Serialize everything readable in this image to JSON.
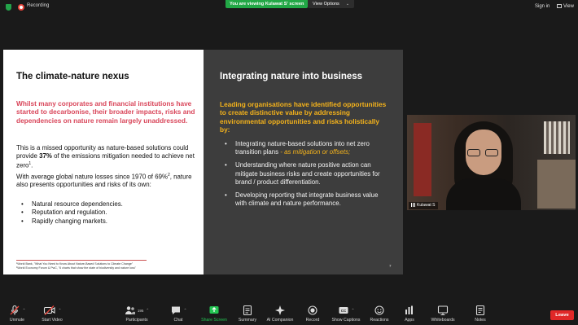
{
  "topbar": {
    "recording_label": "Recording",
    "viewing_banner": "You are viewing Kulawat S' screen",
    "view_options_label": "View Options",
    "sign_in_label": "Sign in",
    "view_label": "View"
  },
  "slide": {
    "left": {
      "title": "The climate-nature nexus",
      "highlight": "Whilst many corporates and financial institutions have started to decarbonise, their broader impacts, risks and dependencies on nature remain largely unaddressed.",
      "p1_before": "This is a missed opportunity as nature-based solutions could provide ",
      "p1_bold": "37%",
      "p1_after": " of the emissions mitigation needed to achieve net zero",
      "p1_sup": "1",
      "p1_end": ".",
      "p2_before": "With average global nature losses since 1970 of 69%",
      "p2_sup": "2",
      "p2_after": ", nature also presents opportunities and risks of its own:",
      "bullets": [
        "Natural resource dependencies.",
        "Reputation and regulation.",
        "Rapidly changing markets."
      ],
      "footnote1": "¹World Bank, \"What You Need to Know About Nature-Based Solutions to Climate Change\"",
      "footnote2": "²World Economy Forum & PwC, \"6 charts that show the state of biodiversity and nature loss\""
    },
    "right": {
      "title": "Integrating nature into business",
      "highlight": "Leading organisations have identified opportunities to create distinctive value by addressing environmental opportunities and risks holistically by:",
      "bullet1_main": "Integrating nature-based solutions into net zero transition plans",
      "bullet1_em": " - as mitigation or offsets;",
      "bullet2": "Understanding where nature positive action can  mitigate business risks and create opportunities for brand / product differentiation.",
      "bullet3": "Developing reporting that integrate business value with climate and nature performance.",
      "page_number": "7"
    }
  },
  "video": {
    "participant_name": "Kulawat S"
  },
  "toolbar": {
    "items": [
      {
        "label": "Unmute",
        "icon": "mic-muted-icon"
      },
      {
        "label": "Start Video",
        "icon": "video-off-icon"
      },
      {
        "label": "Participants",
        "icon": "participants-icon",
        "count": "195"
      },
      {
        "label": "Chat",
        "icon": "chat-icon"
      },
      {
        "label": "Share Screen",
        "icon": "share-screen-icon"
      },
      {
        "label": "Summary",
        "icon": "summary-icon"
      },
      {
        "label": "AI Companion",
        "icon": "ai-companion-icon"
      },
      {
        "label": "Record",
        "icon": "record-icon"
      },
      {
        "label": "Show Captions",
        "icon": "captions-icon"
      },
      {
        "label": "Reactions",
        "icon": "reactions-icon"
      },
      {
        "label": "Apps",
        "icon": "apps-icon"
      },
      {
        "label": "Whiteboards",
        "icon": "whiteboards-icon"
      },
      {
        "label": "Notes",
        "icon": "notes-icon"
      }
    ],
    "leave_label": "Leave"
  },
  "colors": {
    "accent_green": "#23c552",
    "leave_red": "#e02828",
    "slide_pink": "#d9475b",
    "slide_orange": "#f5b31b"
  }
}
